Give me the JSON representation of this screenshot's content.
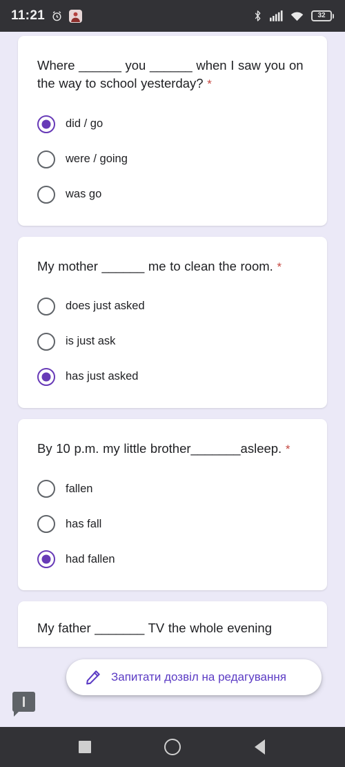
{
  "status_bar": {
    "time": "11:21",
    "alarm_icon": "alarm-clock-icon",
    "notification_icon": "app-notification-icon",
    "bluetooth_icon": "bluetooth-icon",
    "signal_icon": "cellular-signal-icon",
    "wifi_icon": "wifi-icon",
    "battery_level": "32"
  },
  "form": {
    "questions": [
      {
        "text": "Where ______ you ______ when I saw you on the way to school yesterday?",
        "required_marker": "*",
        "options": [
          {
            "label": "did / go",
            "selected": true
          },
          {
            "label": "were / going",
            "selected": false
          },
          {
            "label": "was go",
            "selected": false
          }
        ]
      },
      {
        "text": "My mother ______ me to clean the room.",
        "required_marker": "*",
        "options": [
          {
            "label": "does just asked",
            "selected": false
          },
          {
            "label": "is just ask",
            "selected": false
          },
          {
            "label": "has just asked",
            "selected": true
          }
        ]
      },
      {
        "text": "By 10 p.m. my little brother_______asleep.",
        "required_marker": "*",
        "options": [
          {
            "label": "fallen",
            "selected": false
          },
          {
            "label": "has fall",
            "selected": false
          },
          {
            "label": "had fallen",
            "selected": true
          }
        ]
      },
      {
        "text": "My father _______ TV the whole evening",
        "required_marker": "",
        "options": []
      }
    ]
  },
  "request_edit": {
    "label": "Запитати дозвіл на редагування",
    "icon": "pencil-icon",
    "accent_color": "#5b3bc4"
  },
  "comment_marker": {
    "icon": "comment-alert-icon"
  },
  "nav_bar": {
    "recents_icon": "square-recents-icon",
    "home_icon": "circle-home-icon",
    "back_icon": "triangle-back-icon"
  },
  "colors": {
    "page_background": "#ebe9f7",
    "card_background": "#ffffff",
    "radio_selected": "#673ab7",
    "radio_unselected": "#5f6368",
    "required_star": "#c5463f",
    "text_primary": "#202124",
    "status_bar": "#323236"
  }
}
